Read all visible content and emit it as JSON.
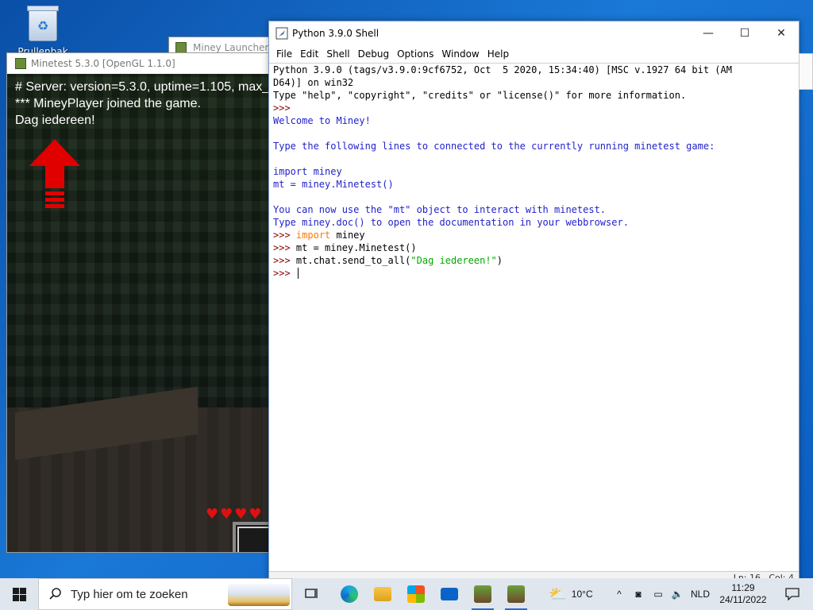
{
  "desktop": {
    "recycle_bin_label": "Prullenbak"
  },
  "launcher_window": {
    "title": "Miney Launcher -"
  },
  "minetest_window": {
    "title": "Minetest 5.3.0 [OpenGL 1.1.0]",
    "chat_lines": [
      "# Server: version=5.3.0, uptime=1.105, max_",
      "*** MineyPlayer joined the game.",
      "Dag iedereen!"
    ],
    "hearts": "♥♥♥♥"
  },
  "python_window": {
    "title": "Python 3.9.0 Shell",
    "menu": [
      "File",
      "Edit",
      "Shell",
      "Debug",
      "Options",
      "Window",
      "Help"
    ],
    "shell": {
      "banner1": "Python 3.9.0 (tags/v3.9.0:9cf6752, Oct  5 2020, 15:34:40) [MSC v.1927 64 bit (AM",
      "banner2": "D64)] on win32",
      "banner3": "Type \"help\", \"copyright\", \"credits\" or \"license()\" for more information.",
      "prompt": ">>>",
      "welcome": "Welcome to Miney!",
      "instructions": "Type the following lines to connected to the currently running minetest game:",
      "example1": "import miney",
      "example2": "mt = miney.Minetest()",
      "usage1": "You can now use the \"mt\" object to interact with minetest.",
      "usage2": "Type miney.doc() to open the documentation in your webbrowser.",
      "cmd1_keyword": "import",
      "cmd1_rest": " miney",
      "cmd2": " mt = miney.Minetest()",
      "cmd3_code": " mt.chat.send_to_all(",
      "cmd3_string": "\"Dag iedereen!\"",
      "cmd3_end": ")"
    },
    "status": {
      "line": "Ln: 16",
      "col": "Col: 4"
    }
  },
  "taskbar": {
    "search_placeholder": "Typ hier om te zoeken",
    "weather": "10°C",
    "language": "NLD",
    "time": "11:29",
    "date": "24/11/2022"
  }
}
